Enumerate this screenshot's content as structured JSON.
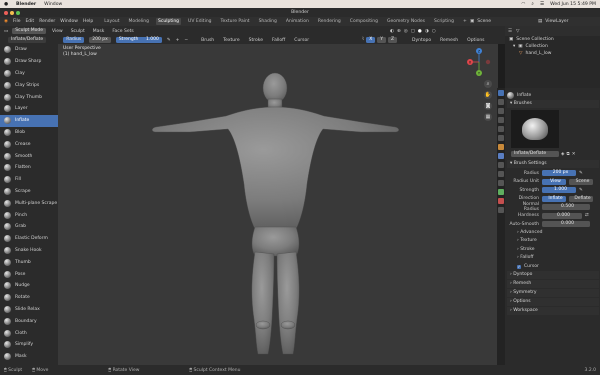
{
  "macbar": {
    "apple": "",
    "app": "Blender",
    "window": "Window",
    "right_date": "Wed Jun 15  5:49 PM"
  },
  "titlebar": {
    "title": "Blender"
  },
  "topbar": {
    "menus": [
      "File",
      "Edit",
      "Render",
      "Window",
      "Help"
    ],
    "workspaces": [
      "Layout",
      "Modeling",
      "Sculpting",
      "UV Editing",
      "Texture Paint",
      "Shading",
      "Animation",
      "Rendering",
      "Compositing",
      "Geometry Nodes",
      "Scripting"
    ],
    "active_workspace": "Sculpting",
    "add_tab": "+",
    "scene_label": "Scene",
    "viewlayer_label": "ViewLayer"
  },
  "header": {
    "mode": "Sculpt Mode",
    "menus": [
      "View",
      "Sculpt",
      "Mask",
      "Face Sets"
    ],
    "brush_name": "Inflate/Deflate",
    "radius_label": "Radius",
    "radius_value": "200 px",
    "strength_label": "Strength",
    "strength_value": "1.000",
    "dropdowns": [
      "Brush",
      "Texture",
      "Stroke",
      "Falloff",
      "Cursor"
    ],
    "xyz": [
      "X",
      "Y",
      "Z"
    ],
    "right": [
      "Dyntopo",
      "Remesh",
      "Options"
    ]
  },
  "tools": [
    "Draw",
    "Draw Sharp",
    "Clay",
    "Clay Strips",
    "Clay Thumb",
    "Layer",
    "Inflate",
    "Blob",
    "Crease",
    "Smooth",
    "Flatten",
    "Fill",
    "Scrape",
    "Multi-plane Scrape",
    "Pinch",
    "Grab",
    "Elastic Deform",
    "Snake Hook",
    "Thumb",
    "Pose",
    "Nudge",
    "Rotate",
    "Slide Relax",
    "Boundary",
    "Cloth",
    "Simplify",
    "Mask"
  ],
  "active_tool": "Inflate",
  "viewport": {
    "line1": "User Perspective",
    "line2": "(1) hand_L_low"
  },
  "gizmo": {
    "x": "X",
    "y": "Y",
    "z": "Z"
  },
  "outliner": {
    "title": "Scene Collection",
    "collection": "Collection",
    "object": "hand_L_low"
  },
  "properties": {
    "brush_title": "Inflate",
    "brushes_section": "Brushes",
    "brush_field": "Inflate/Deflate",
    "brush_settings": "Brush Settings",
    "radius_label": "Radius",
    "radius_value": "200 px",
    "radius_unit_label": "Radius Unit",
    "radius_unit_view": "View",
    "radius_unit_scene": "Scene",
    "strength_label": "Strength",
    "strength_value": "1.000",
    "direction_label": "Direction",
    "direction_inflate": "Inflate",
    "direction_deflate": "Deflate",
    "normal_radius_label": "Normal Radius",
    "normal_radius_value": "0.500",
    "hardness_label": "Hardness",
    "hardness_value": "0.000",
    "autosmooth_label": "Auto-Smooth",
    "autosmooth_value": "0.000",
    "subpanels": [
      "Advanced",
      "Texture",
      "Stroke",
      "Falloff"
    ],
    "cursor": "Cursor",
    "sections": [
      "Dyntopo",
      "Remesh",
      "Symmetry",
      "Options",
      "Workspace"
    ]
  },
  "statusbar": {
    "items": [
      "Sculpt",
      "Move",
      "Rotate View",
      "Sculpt Context Menu"
    ],
    "version": "3.2.0"
  },
  "colors": {
    "accent": "#4772b3",
    "viewport_bg": "#393939",
    "panel_bg": "#2b2b2b",
    "axis_x": "#e0464b",
    "axis_y": "#6fb43a",
    "axis_z": "#3f82d6"
  }
}
